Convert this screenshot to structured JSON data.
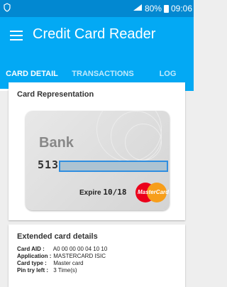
{
  "status": {
    "battery": "80%",
    "time": "09:06"
  },
  "appbar": {
    "title": "Credit Card Reader"
  },
  "tabs": [
    {
      "label": "CARD DETAIL"
    },
    {
      "label": "TRANSACTIONS"
    },
    {
      "label": "LOG"
    }
  ],
  "card_rep": {
    "heading": "Card Representation",
    "bank": "Bank",
    "number": "513",
    "expire_label": "Expire",
    "expire_date": "10/18",
    "brand": "MasterCard"
  },
  "extended": {
    "heading": "Extended card details",
    "rows": [
      {
        "key": "Card AID :",
        "value": "A0 00 00 00 04 10 10"
      },
      {
        "key": "Application :",
        "value": "MASTERCARD ISIC"
      },
      {
        "key": "Card type :",
        "value": "Master card"
      },
      {
        "key": "Pin try left :",
        "value": "3 Time(s)"
      }
    ]
  },
  "colors": {
    "primary": "#03a9f4",
    "status": "#0288d1"
  }
}
